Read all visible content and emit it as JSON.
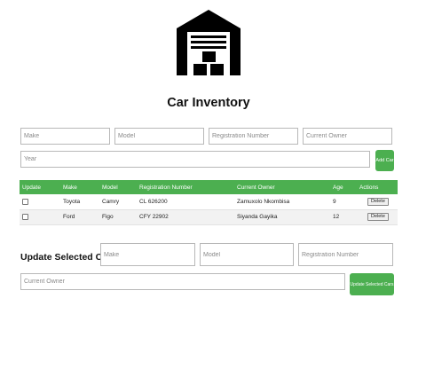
{
  "header": {
    "title": "Car Inventory",
    "logo_icon": "garage-icon"
  },
  "add_form": {
    "make_placeholder": "Make",
    "model_placeholder": "Model",
    "registration_placeholder": "Registration Number",
    "owner_placeholder": "Current Owner",
    "year_placeholder": "Year",
    "add_button": "Add Car"
  },
  "table": {
    "headers": [
      "Update",
      "Make",
      "Model",
      "Registration Number",
      "Current Owner",
      "Age",
      "Actions"
    ],
    "rows": [
      {
        "make": "Toyota",
        "model": "Camry",
        "registration": "CL 626200",
        "owner": "Zamuxolo Nkombisa",
        "age": "9",
        "action": "Delete"
      },
      {
        "make": "Ford",
        "model": "Figo",
        "registration": "CFY 22902",
        "owner": "Siyanda Gayika",
        "age": "12",
        "action": "Delete"
      }
    ]
  },
  "update_form": {
    "title": "Update Selected Cars",
    "make_placeholder": "Make",
    "model_placeholder": "Model",
    "registration_placeholder": "Registration Number",
    "owner_placeholder": "Current Owner",
    "update_button": "Update Selected Cars"
  },
  "colors": {
    "accent": "#4caf50"
  }
}
